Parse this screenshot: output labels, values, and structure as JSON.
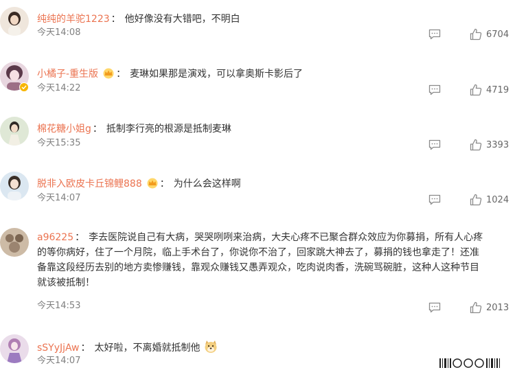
{
  "comments": [
    {
      "username": "纯纯的羊驼1223",
      "text": "他好像没有大错吧，不明白",
      "time": "今天14:08",
      "likes": "6704",
      "crown": false,
      "verified": false,
      "avatar_color": "#d9c3b1"
    },
    {
      "username": "小橘子-重生版",
      "text": "麦琳如果那是演戏，可以拿奥斯卡影后了",
      "time": "今天14:22",
      "likes": "4719",
      "crown": true,
      "verified": true,
      "avatar_color": "#8c5a6e"
    },
    {
      "username": "棉花糖小姐g",
      "text": "抵制李行亮的根源是抵制麦琳",
      "time": "今天15:35",
      "likes": "3393",
      "crown": false,
      "verified": false,
      "avatar_color": "#c5d6b8"
    },
    {
      "username": "脱非入欧皮卡丘锦鲤888",
      "text": "为什么会这样啊",
      "time": "今天14:07",
      "likes": "1024",
      "crown": true,
      "verified": false,
      "avatar_color": "#a9c7de"
    },
    {
      "username": "a96225",
      "text_lines": [
        "李去医院说自己有大病，哭哭咧咧来治病，大夫心疼不已聚合群众效应为你募捐，所有人心疼",
        "的等你病好，住了一个月院，临上手术台了，你说你不治了，回家跳大神去了，募捐的钱也拿走了！还准",
        "备靠这段经历去别的地方卖惨赚钱，靠观众赚钱又愚弄观众，吃肉说肉香，洗碗骂碗脏，这种人这种节目",
        "就该被抵制！"
      ],
      "time": "今天14:53",
      "likes": "2013",
      "crown": false,
      "verified": false,
      "avatar_color": "#a8927c"
    },
    {
      "username": "sSYyJjAw",
      "text": "太好啦，不离婚就抵制他",
      "time": "今天14:07",
      "crown": false,
      "verified": false,
      "avatar_color": "#c8a9c9"
    }
  ],
  "colors": {
    "username": "#eb7350",
    "text": "#333333",
    "meta": "#808080"
  },
  "icons": {
    "reply": "comment-icon",
    "like": "thumbs-up-icon",
    "member": "crown-icon",
    "emoji": "doge-emoji"
  }
}
